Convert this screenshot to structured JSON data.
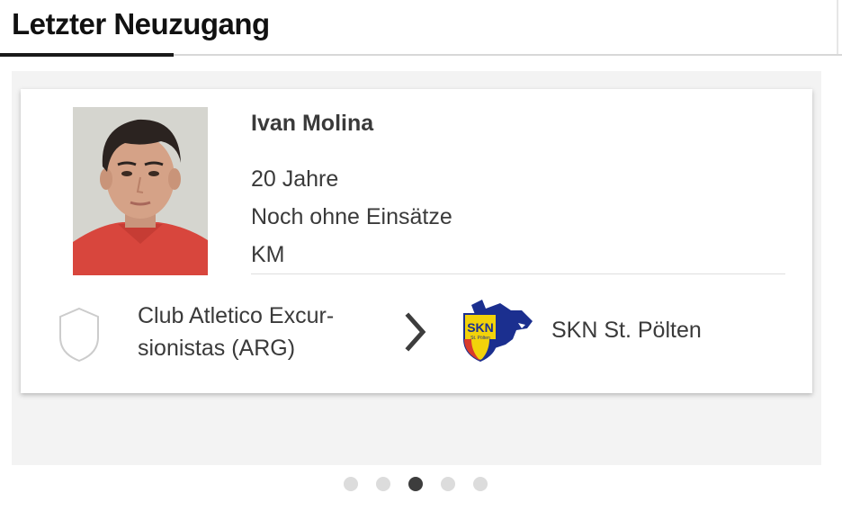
{
  "section": {
    "title": "Letzter Neuzugang"
  },
  "transfer": {
    "player_name": "Ivan Molina",
    "age": "20 Jahre",
    "appearances": "Noch ohne Einsätze",
    "team": "KM",
    "from_club": "Club Atletico Excur-\nsionistas (ARG)",
    "to_club": "SKN St. Pölten",
    "to_logo_text": "SKN",
    "to_logo_subtext": "St. Pölten"
  },
  "carousel": {
    "dot_count": 5,
    "active_index": 2
  },
  "colors": {
    "accent_underline": "#1a1a1a",
    "panel_bg": "#f3f3f3",
    "active_dot": "#3d3d3d",
    "inactive_dot": "#dcdcdc",
    "skn_blue": "#1b2f8f",
    "skn_yellow": "#f2d20a"
  }
}
